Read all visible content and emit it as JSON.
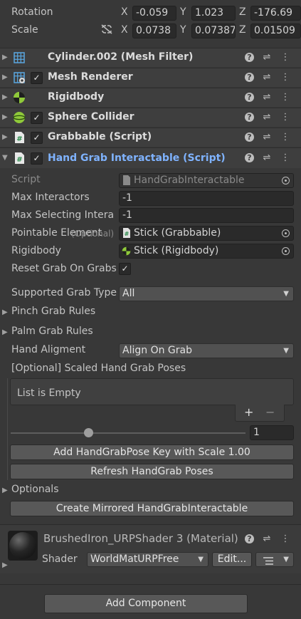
{
  "transform": {
    "rotation_label": "Rotation",
    "scale_label": "Scale",
    "x": "X",
    "y": "Y",
    "z": "Z",
    "rotation": {
      "x": "-0.059",
      "y": "1.023",
      "z": "-176.69"
    },
    "scale": {
      "x": "0.0738",
      "y": "0.07387",
      "z": "0.01509"
    }
  },
  "components": [
    {
      "title": "Cylinder.002 (Mesh Filter)",
      "icon": "mesh-filter-icon",
      "checkbox": false
    },
    {
      "title": "Mesh Renderer",
      "icon": "mesh-renderer-icon",
      "checkbox": true
    },
    {
      "title": "Rigidbody",
      "icon": "rigidbody-icon",
      "checkbox": false
    },
    {
      "title": "Sphere Collider",
      "icon": "sphere-collider-icon",
      "checkbox": true
    },
    {
      "title": "Grabbable (Script)",
      "icon": "script-icon",
      "checkbox": true
    },
    {
      "title": "Hand Grab Interactable (Script)",
      "icon": "script-icon",
      "checkbox": true,
      "expanded": true
    }
  ],
  "hand_grab": {
    "script_label": "Script",
    "script_value": "HandGrabInteractable",
    "max_interactors_label": "Max Interactors",
    "max_interactors_value": "-1",
    "max_selecting_label": "Max Selecting Intera",
    "max_selecting_value": "-1",
    "pointable_label": "Pointable Element",
    "pointable_optional": "(Optional)",
    "pointable_value": "Stick (Grabbable)",
    "rigidbody_label": "Rigidbody",
    "rigidbody_value": "Stick (Rigidbody)",
    "reset_label": "Reset Grab On Grabs",
    "reset_checked": "✓",
    "supported_label": "Supported Grab Type",
    "supported_value": "All",
    "pinch_label": "Pinch Grab Rules",
    "palm_label": "Palm Grab Rules",
    "alignment_label": "Hand Aligment",
    "alignment_value": "Align On Grab",
    "poses_label": "[Optional] Scaled Hand Grab Poses",
    "list_empty": "List is Empty",
    "add_symbol": "+",
    "remove_symbol": "−",
    "slider_value": "1",
    "slider_fraction": 0.33,
    "add_pose_button": "Add HandGrabPose Key with Scale 1.00",
    "refresh_button": "Refresh HandGrab Poses",
    "optionals_label": "Optionals",
    "mirror_button": "Create Mirrored HandGrabInteractable"
  },
  "material": {
    "name": "BrushedIron_URPShader 3 (Material)",
    "shader_label": "Shader",
    "shader_value": "WorldMatURPFree",
    "edit_button": "Edit...",
    "list_icon": "list-icon"
  },
  "add_component_button": "Add Component",
  "colors": {
    "accent": "#7fb3ff",
    "background": "#383838",
    "header": "#3e3e3e"
  }
}
